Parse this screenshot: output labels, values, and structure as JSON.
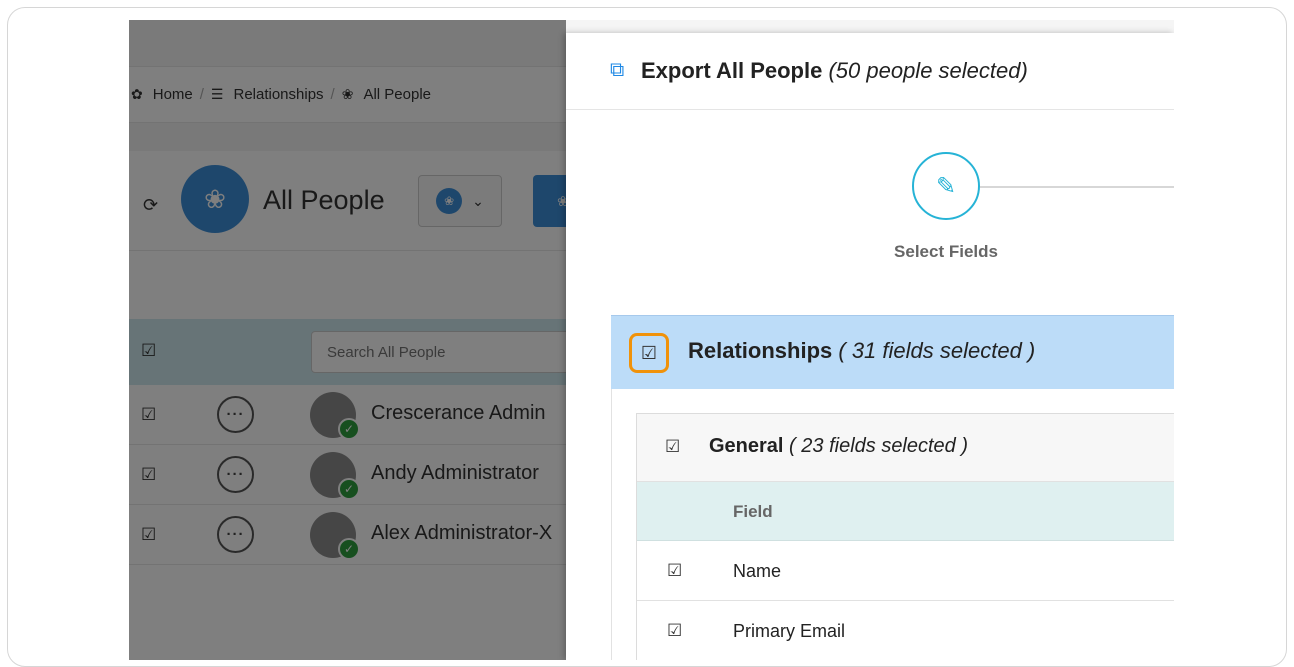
{
  "breadcrumb": {
    "home": "Home",
    "relationships": "Relationships",
    "all_people": "All People",
    "separator": "/"
  },
  "people_page": {
    "title": "All People",
    "search_placeholder": "Search All People",
    "rows": [
      {
        "name": "Crescerance Admin"
      },
      {
        "name": "Andy Administrator"
      },
      {
        "name": "Alex Administrator-X"
      }
    ]
  },
  "modal": {
    "title": "Export All People",
    "subtitle": "(50 people selected)",
    "step_label": "Select Fields",
    "relationships": {
      "title": "Relationships",
      "count": "( 31 fields selected )"
    },
    "general": {
      "title": "General",
      "count": "( 23 fields selected )"
    },
    "field_header": "Field",
    "fields": [
      {
        "name": "Name"
      },
      {
        "name": "Primary Email"
      }
    ]
  },
  "icons": {
    "checkbox": "checked-box-icon",
    "export": "export-icon",
    "step": "edit-pen-icon",
    "refresh": "refresh-icon",
    "people": "people-group-icon"
  },
  "colors": {
    "accent_blue": "#3d8fd9",
    "step_teal": "#26b3d6",
    "highlight_orange": "#f0920a",
    "panel_blue": "#bcdcf8",
    "field_head": "#dff0f0"
  }
}
